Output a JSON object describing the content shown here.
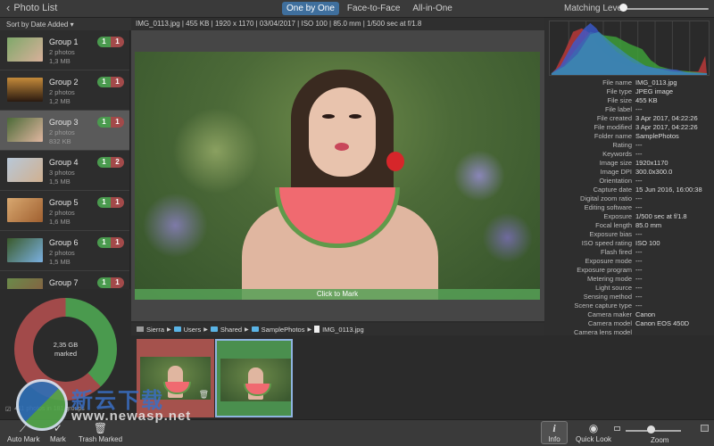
{
  "topbar": {
    "back_label": "Photo List",
    "modes": [
      "One by One",
      "Face-to-Face",
      "All-in-One"
    ],
    "active_mode": "One by One",
    "matching_label": "Matching Level:",
    "matching_level": 0
  },
  "sidebar": {
    "sort_label": "Sort by Date Added ▾",
    "groups": [
      {
        "name": "Group 1",
        "photos": "2 photos",
        "size": "1,3 MB",
        "keep": "1",
        "del": "1"
      },
      {
        "name": "Group 2",
        "photos": "2 photos",
        "size": "1,2 MB",
        "keep": "1",
        "del": "1"
      },
      {
        "name": "Group 3",
        "photos": "2 photos",
        "size": "832 KB",
        "keep": "1",
        "del": "1"
      },
      {
        "name": "Group 4",
        "photos": "3 photos",
        "size": "1,5 MB",
        "keep": "1",
        "del": "2"
      },
      {
        "name": "Group 5",
        "photos": "2 photos",
        "size": "1,6 MB",
        "keep": "1",
        "del": "1"
      },
      {
        "name": "Group 6",
        "photos": "2 photos",
        "size": "1,5 MB",
        "keep": "1",
        "del": "1"
      },
      {
        "name": "Group 7",
        "photos": "",
        "size": "",
        "keep": "1",
        "del": "1"
      }
    ],
    "selected_group": "Group 3",
    "donut": {
      "value": "2,35 GB",
      "label": "marked",
      "marked_fraction": 0.62
    },
    "status": "411 photos in 181 groups"
  },
  "viewer": {
    "info": "IMG_0113.jpg | 455 KB | 1920 x 1170 | 03/04/2017 | ISO 100 | 85.0 mm | 1/500 sec at f/1.8",
    "click_label": "Click to Mark"
  },
  "path": {
    "items": [
      "Sierra",
      "Users",
      "Shared",
      "SamplePhotos",
      "IMG_0113.jpg"
    ]
  },
  "metadata": [
    {
      "label": "File name",
      "value": "IMG_0113.jpg"
    },
    {
      "label": "File type",
      "value": "JPEG image"
    },
    {
      "label": "File size",
      "value": "455 KB"
    },
    {
      "label": "File label",
      "value": "---"
    },
    {
      "label": "File created",
      "value": "3 Apr 2017, 04:22:26"
    },
    {
      "label": "File modified",
      "value": "3 Apr 2017, 04:22:26"
    },
    {
      "label": "Folder name",
      "value": "SamplePhotos"
    },
    {
      "label": "Rating",
      "value": "---"
    },
    {
      "label": "Keywords",
      "value": "---"
    },
    {
      "label": "Image size",
      "value": "1920x1170"
    },
    {
      "label": "Image DPI",
      "value": "300.0x300.0"
    },
    {
      "label": "Orientation",
      "value": "---"
    },
    {
      "label": "Capture date",
      "value": "15 Jun 2016, 16:00:38"
    },
    {
      "label": "Digital zoom ratio",
      "value": "---"
    },
    {
      "label": "Editing software",
      "value": "---"
    },
    {
      "label": "Exposure",
      "value": "1/500 sec at f/1.8"
    },
    {
      "label": "Focal length",
      "value": "85.0 mm"
    },
    {
      "label": "Exposure bias",
      "value": "---"
    },
    {
      "label": "ISO speed rating",
      "value": "ISO 100"
    },
    {
      "label": "Flash fired",
      "value": "---"
    },
    {
      "label": "Exposure mode",
      "value": "---"
    },
    {
      "label": "Exposure program",
      "value": "---"
    },
    {
      "label": "Metering mode",
      "value": "---"
    },
    {
      "label": "Light source",
      "value": "---"
    },
    {
      "label": "Sensing method",
      "value": "---"
    },
    {
      "label": "Scene capture type",
      "value": "---"
    },
    {
      "label": "Camera maker",
      "value": "Canon"
    },
    {
      "label": "Camera model",
      "value": "Canon EOS 450D"
    },
    {
      "label": "Camera lens model",
      "value": ""
    }
  ],
  "toolbar": {
    "auto_mark": "Auto Mark",
    "mark": "Mark",
    "trash_marked": "Trash Marked",
    "info": "Info",
    "quick_look": "Quick Look",
    "zoom": "Zoom",
    "zoom_level": 0.45
  },
  "watermark": {
    "text": "新云下载",
    "url": "www.newasp.net"
  },
  "colors": {
    "keep": "#4a9a4e",
    "delete": "#a24a4a",
    "accent": "#3f6f9d"
  }
}
